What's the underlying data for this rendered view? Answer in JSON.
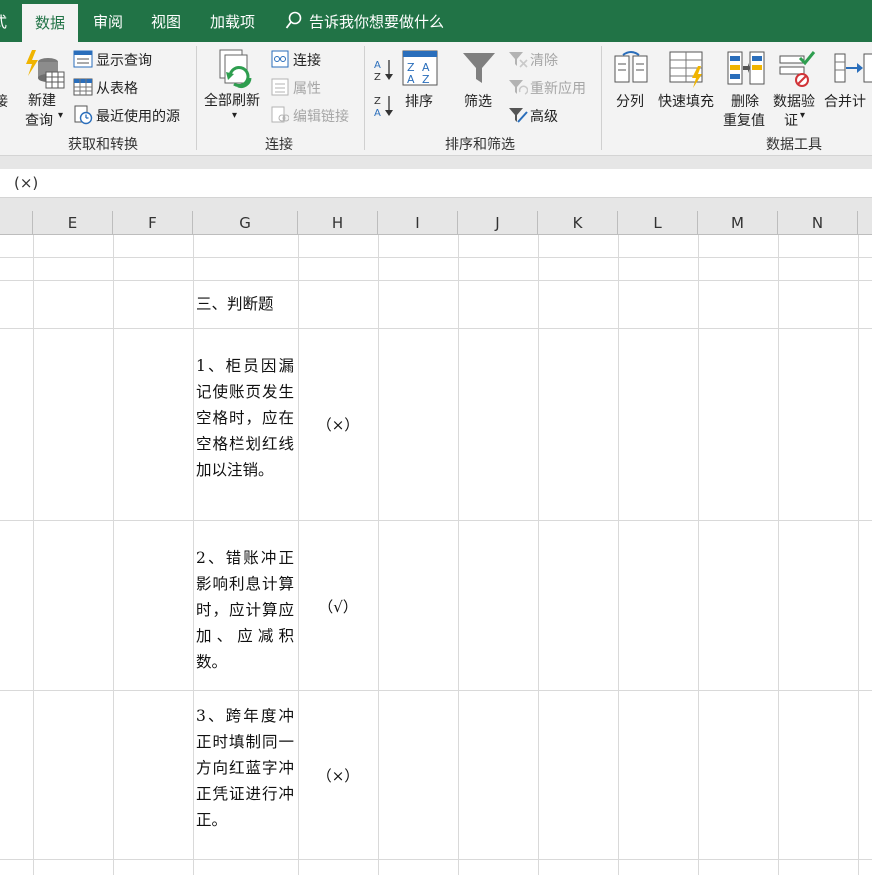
{
  "tabs": [
    {
      "name": "tab-partial",
      "label": "式"
    },
    {
      "name": "tab-data",
      "label": "数据",
      "active": true
    },
    {
      "name": "tab-review",
      "label": "审阅"
    },
    {
      "name": "tab-view",
      "label": "视图"
    },
    {
      "name": "tab-addins",
      "label": "加载项"
    }
  ],
  "tell_me": "告诉我你想要做什么",
  "ribbon": {
    "get_transform": {
      "partial": "接",
      "new_query_1": "新建",
      "new_query_2": "查询",
      "show_queries": "显示查询",
      "from_table": "从表格",
      "recent_sources": "最近使用的源",
      "group_label": "获取和转换"
    },
    "connections": {
      "refresh_all": "全部刷新",
      "connections": "连接",
      "properties": "属性",
      "edit_links": "编辑链接",
      "group_label": "连接"
    },
    "sort_filter": {
      "sort": "排序",
      "filter": "筛选",
      "clear": "清除",
      "reapply": "重新应用",
      "advanced": "高级",
      "group_label": "排序和筛选"
    },
    "data_tools": {
      "text_to_columns": "分列",
      "flash_fill": "快速填充",
      "remove_dup_1": "删除",
      "remove_dup_2": "重复值",
      "validation_1": "数据验",
      "validation_2": "证",
      "consolidate": "合并计",
      "group_label": "数据工具"
    }
  },
  "formula_bar": "(×)",
  "columns": [
    "E",
    "F",
    "G",
    "H",
    "I",
    "J",
    "K",
    "L",
    "M",
    "N"
  ],
  "cells": {
    "section_title": "三、判断题",
    "q1": "1、柜员因漏记使账页发生空格时，应在空格栏划红线加以注销。",
    "a1": "（×）",
    "q2": "2、错账冲正影响利息计算时，应计算应加、应减积数。",
    "a2": "（√）",
    "q3": "3、跨年度冲正时填制同一方向红蓝字冲正凭证进行冲正。",
    "a3": "（×）"
  },
  "colors": {
    "excel_green": "#217346",
    "ribbon_bg": "#f3f3f3",
    "gridline": "#d9d9d9"
  }
}
